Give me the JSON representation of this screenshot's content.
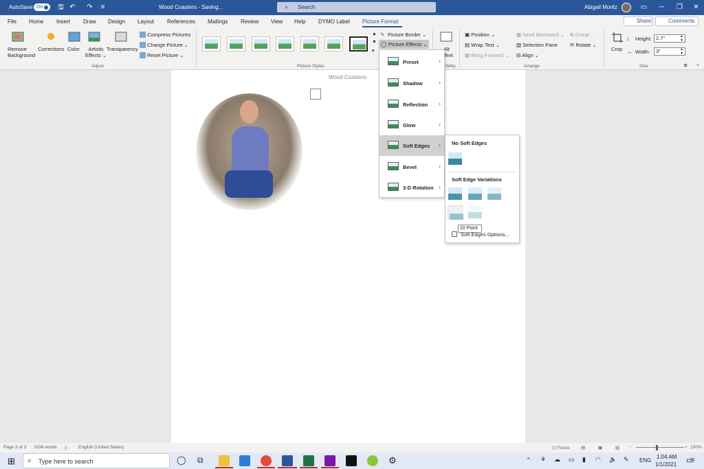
{
  "titlebar": {
    "autosave": "AutoSave",
    "toggle": "On",
    "doc_title": "Wood Coasters - Saving...",
    "search": "Search",
    "user": "Abigail Moritz"
  },
  "tabs": [
    "File",
    "Home",
    "Insert",
    "Draw",
    "Design",
    "Layout",
    "References",
    "Mailings",
    "Review",
    "View",
    "Help",
    "DYMO Label",
    "Picture Format"
  ],
  "share": "Share",
  "comments": "Comments",
  "ribbon": {
    "remove_bg": "Remove Background",
    "corrections": "Corrections",
    "color": "Color",
    "artistic": "Artistic Effects",
    "transparency": "Transparency",
    "compress": "Compress Pictures",
    "change": "Change Picture",
    "reset": "Reset Picture",
    "adjust": "Adjust",
    "picture_styles": "Picture Styles",
    "border": "Picture Border",
    "effects": "Picture Effects",
    "alt": "Alt Text",
    "accessibility": "ibility",
    "position": "Position",
    "wrap": "Wrap Text",
    "bring": "Bring Forward",
    "send": "Send Backward",
    "selection": "Selection Pane",
    "align": "Align",
    "group": "Group",
    "rotate": "Rotate",
    "arrange": "Arrange",
    "crop": "Crop",
    "height_label": "Height:",
    "height": "2.7\"",
    "width_label": "Width:",
    "width": "3\"",
    "size": "Size"
  },
  "document": {
    "header": "Wood Coasters"
  },
  "effects_menu": [
    "Preset",
    "Shadow",
    "Reflection",
    "Glow",
    "Soft Edges",
    "Bevel",
    "3-D Rotation"
  ],
  "submenu": {
    "none_title": "No Soft Edges",
    "variations_title": "Soft Edge Variations",
    "tooltip": "10 Point",
    "options": "Soft Edges Options..."
  },
  "status": {
    "page": "Page 3 of 3",
    "words": "1034 words",
    "lang": "English (United States)",
    "focus": "Focus",
    "zoom": "100%"
  },
  "taskbar": {
    "search": "Type here to search",
    "time": "1:04 AM",
    "date": "1/1/2021",
    "lang": "ENG",
    "notif": "21"
  }
}
